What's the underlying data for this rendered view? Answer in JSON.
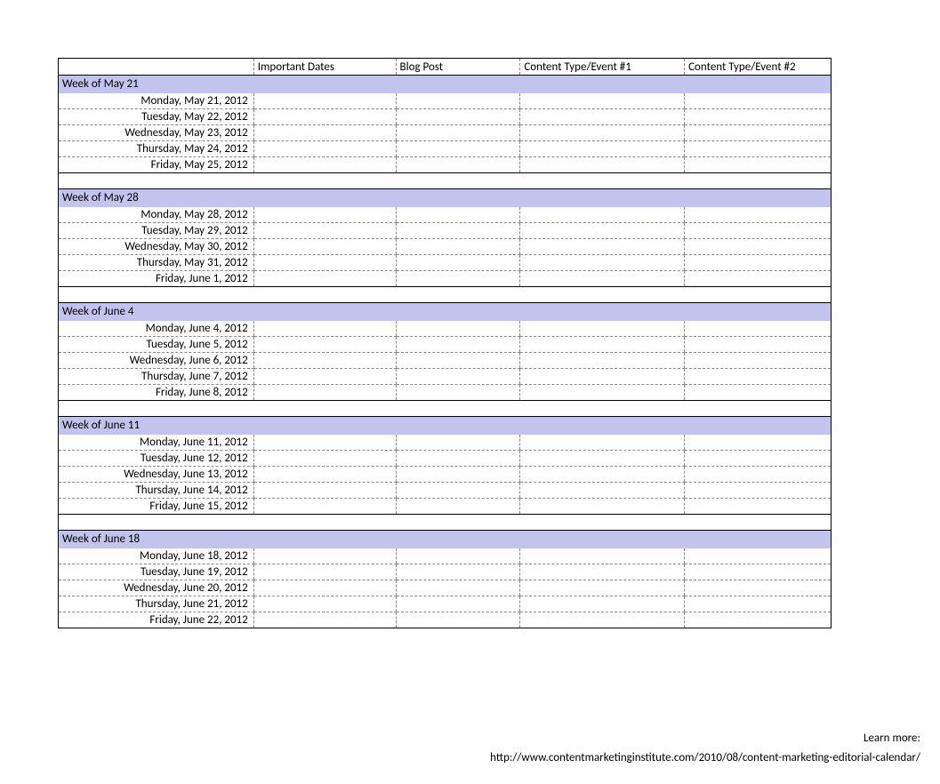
{
  "headers": {
    "dates": "Important Dates",
    "blog": "Blog Post",
    "event1": "Content Type/Event #1",
    "event2": "Content Type/Event #2"
  },
  "weeks": [
    {
      "label": "Week of May 21",
      "days": [
        "Monday, May 21, 2012",
        "Tuesday, May 22, 2012",
        "Wednesday, May 23, 2012",
        "Thursday, May 24, 2012",
        "Friday, May 25, 2012"
      ]
    },
    {
      "label": "Week of May 28",
      "days": [
        "Monday, May 28, 2012",
        "Tuesday, May 29, 2012",
        "Wednesday, May 30, 2012",
        "Thursday, May 31, 2012",
        "Friday, June 1, 2012"
      ]
    },
    {
      "label": "Week of June 4",
      "days": [
        "Monday, June 4, 2012",
        "Tuesday, June 5, 2012",
        "Wednesday, June 6, 2012",
        "Thursday, June 7, 2012",
        "Friday, June 8, 2012"
      ]
    },
    {
      "label": "Week of June 11",
      "days": [
        "Monday, June 11, 2012",
        "Tuesday, June 12, 2012",
        "Wednesday, June 13, 2012",
        "Thursday, June 14, 2012",
        "Friday, June 15, 2012"
      ]
    },
    {
      "label": "Week of June 18",
      "days": [
        "Monday, June 18, 2012",
        "Tuesday, June 19, 2012",
        "Wednesday, June 20, 2012",
        "Thursday, June 21, 2012",
        "Friday, June 22, 2012"
      ]
    }
  ],
  "footer": {
    "label": "Learn more:",
    "url": "http://www.contentmarketinginstitute.com/2010/08/content-marketing-editorial-calendar/"
  }
}
